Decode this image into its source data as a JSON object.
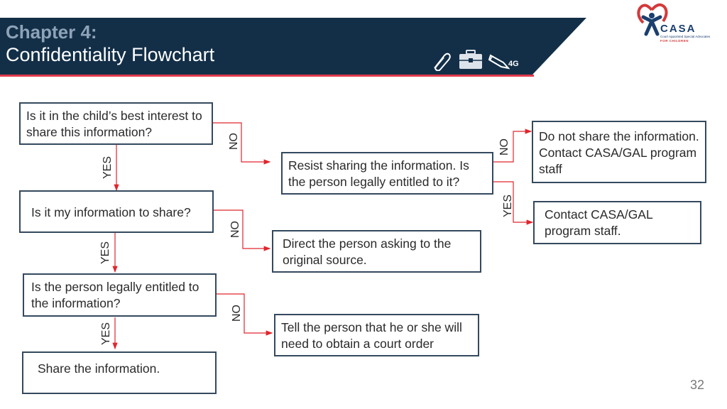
{
  "header": {
    "chapter": "Chapter 4:",
    "title": "Confidentiality Flowchart",
    "icons": [
      "paperclip-icon",
      "briefcase-icon",
      "pencil-icon"
    ],
    "icon_tag": "4G",
    "colors": {
      "banner": "#132f48",
      "accent_line": "#e03a4b",
      "chapter_text": "#8ea3b8"
    }
  },
  "logo": {
    "name": "CASA",
    "subtitle": "Court Appointed Special Advocates",
    "tagline": "FOR CHILDREN"
  },
  "flowchart": {
    "nodes": {
      "q1": "Is it in the child’s best interest to share this information?",
      "q2": "Is it my information to share?",
      "q3": "Is the person legally entitled to the information?",
      "share": "Share the information.",
      "resist": "Resist sharing the information. Is the person legally entitled to it?",
      "do_not_share": "Do not share the information. Contact CASA/GAL program staff",
      "contact_staff": "Contact CASA/GAL program staff.",
      "direct_source": "Direct the person asking to the original source.",
      "court_order": "Tell the person that he or she will need to obtain a court order"
    },
    "labels": {
      "yes": "YES",
      "no": "NO"
    },
    "edges": [
      {
        "from": "q1",
        "to": "q2",
        "label": "YES"
      },
      {
        "from": "q1",
        "to": "resist",
        "label": "NO"
      },
      {
        "from": "resist",
        "to": "do_not_share",
        "label": "NO"
      },
      {
        "from": "resist",
        "to": "contact_staff",
        "label": "YES"
      },
      {
        "from": "q2",
        "to": "q3",
        "label": "YES"
      },
      {
        "from": "q2",
        "to": "direct_source",
        "label": "NO"
      },
      {
        "from": "q3",
        "to": "share",
        "label": "YES"
      },
      {
        "from": "q3",
        "to": "court_order",
        "label": "NO"
      }
    ],
    "colors": {
      "connector": "#e0262e",
      "box_border": "#34495e"
    }
  },
  "page_number": "32"
}
